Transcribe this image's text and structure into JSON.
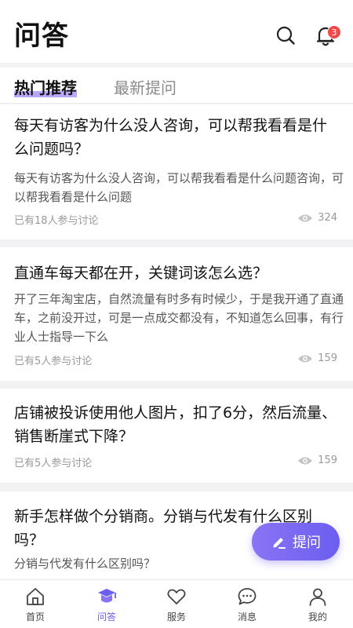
{
  "header": {
    "title": "问答",
    "badge_count": "3"
  },
  "tabs": [
    {
      "label": "热门推荐"
    },
    {
      "label": "最新提问"
    }
  ],
  "posts": [
    {
      "title": "每天有访客为什么没人咨询，可以帮我看看是什么问题吗？",
      "desc": "每天有访客为什么没人咨询，可以帮我看看是什么问题咨询，可以帮我看看是什么问题",
      "participants": "已有18人参与讨论",
      "views": "324"
    },
    {
      "title": "直通车每天都在开，关键词该怎么选？",
      "desc": "开了三年淘宝店，自然流量有时多有时候少，于是我开通了直通车，之前没开过，可是一点成交都没有，不知道怎么回事，有行业人士指导一下么",
      "participants": "已有5人参与讨论",
      "views": "159"
    },
    {
      "title": "店铺被投诉使用他人图片，扣了6分，然后流量、销售断崖式下降？",
      "participants": "已有5人参与讨论",
      "views": "159"
    },
    {
      "title": "新手怎样做个分销商。分销与代发有什么区别吗？",
      "desc": "分销与代发有什么区别吗？"
    }
  ],
  "fab": {
    "label": "提问"
  },
  "tabbar": [
    {
      "label": "首页"
    },
    {
      "label": "问答"
    },
    {
      "label": "服务"
    },
    {
      "label": "消息"
    },
    {
      "label": "我的"
    }
  ],
  "colors": {
    "accent": "#6b5ef0",
    "badge": "#ef4a4a",
    "highlight": "#b9a8f7"
  }
}
